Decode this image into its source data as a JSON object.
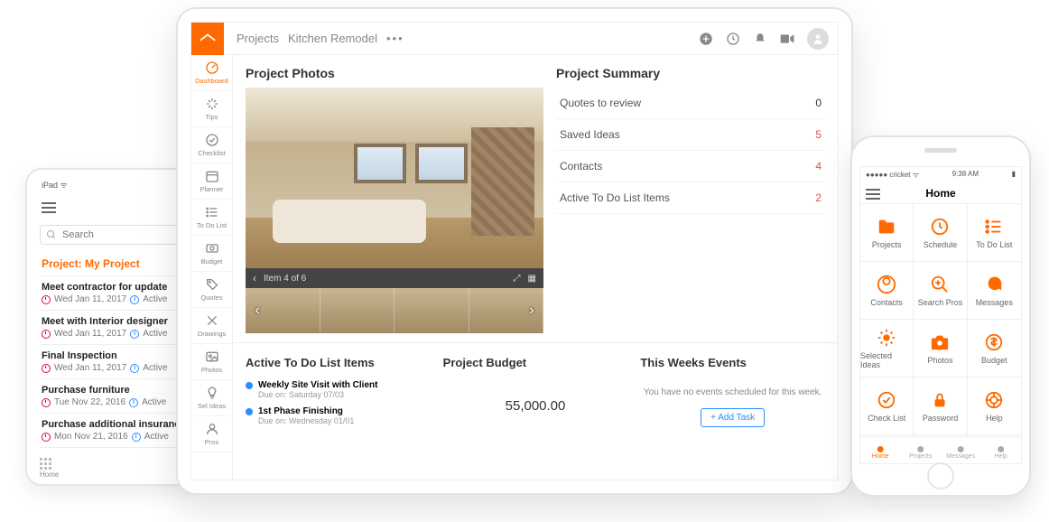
{
  "ipad": {
    "status": "iPad  ᯤ",
    "search_placeholder": "Search",
    "project_label": "Project: My Project",
    "items": [
      {
        "title": "Meet contractor for update",
        "date": "Wed Jan 11, 2017",
        "status": "Active"
      },
      {
        "title": "Meet with Interior designer",
        "date": "Wed Jan 11, 2017",
        "status": "Active"
      },
      {
        "title": "Final Inspection",
        "date": "Wed Jan 11, 2017",
        "status": "Active"
      },
      {
        "title": "Purchase furniture",
        "date": "Tue Nov 22, 2016",
        "status": "Active"
      },
      {
        "title": "Purchase additional insurance",
        "date": "Mon Nov 21, 2016",
        "status": "Active"
      }
    ],
    "footer_label": "Home"
  },
  "tablet": {
    "breadcrumbs": [
      "Projects",
      "Kitchen Remodel"
    ],
    "rail": [
      {
        "label": "Dashboard",
        "icon": "gauge"
      },
      {
        "label": "Tips",
        "icon": "spark"
      },
      {
        "label": "Checklist",
        "icon": "check"
      },
      {
        "label": "Planner",
        "icon": "cal"
      },
      {
        "label": "To Do List",
        "icon": "list"
      },
      {
        "label": "Budget",
        "icon": "money"
      },
      {
        "label": "Quotes",
        "icon": "tag"
      },
      {
        "label": "Drawings",
        "icon": "x"
      },
      {
        "label": "Photos",
        "icon": "photo"
      },
      {
        "label": "Sel Ideas",
        "icon": "bulb"
      },
      {
        "label": "Pros",
        "icon": "person"
      }
    ],
    "photos_title": "Project Photos",
    "photo_counter": "Item 4 of 6",
    "summary_title": "Project Summary",
    "summary_rows": [
      {
        "label": "Quotes to review",
        "value": "0",
        "red": false
      },
      {
        "label": "Saved Ideas",
        "value": "5",
        "red": true
      },
      {
        "label": "Contacts",
        "value": "4",
        "red": true
      },
      {
        "label": "Active To Do List Items",
        "value": "2",
        "red": true
      }
    ],
    "todo_title": "Active To Do List Items",
    "todo_items": [
      {
        "title": "Weekly Site Visit with Client",
        "due": "Due on: Saturday 07/03"
      },
      {
        "title": "1st Phase Finishing",
        "due": "Due on: Wednesday 01/01"
      }
    ],
    "budget_title": "Project Budget",
    "budget_value": "55,000.00",
    "events_title": "This Weeks Events",
    "events_empty": "You have no events scheduled for this week.",
    "add_task": "+ Add Task"
  },
  "phone": {
    "carrier": "●●●●● cricket ᯤ",
    "time": "9:38 AM",
    "title": "Home",
    "tiles": [
      {
        "label": "Projects",
        "icon": "folder"
      },
      {
        "label": "Schedule",
        "icon": "clock"
      },
      {
        "label": "To Do List",
        "icon": "list"
      },
      {
        "label": "Contacts",
        "icon": "person"
      },
      {
        "label": "Search Pros",
        "icon": "search"
      },
      {
        "label": "Messages",
        "icon": "chat"
      },
      {
        "label": "Selected Ideas",
        "icon": "spark"
      },
      {
        "label": "Photos",
        "icon": "camera"
      },
      {
        "label": "Budget",
        "icon": "dollar"
      },
      {
        "label": "Check List",
        "icon": "check"
      },
      {
        "label": "Password",
        "icon": "lock"
      },
      {
        "label": "Help",
        "icon": "life"
      }
    ],
    "tabs": [
      {
        "label": "Home",
        "active": true
      },
      {
        "label": "Projects",
        "active": false
      },
      {
        "label": "Messages",
        "active": false
      },
      {
        "label": "Help",
        "active": false
      }
    ]
  },
  "colors": {
    "accent": "#ff6a00",
    "blue": "#2d8cff",
    "red": "#d9534f"
  }
}
